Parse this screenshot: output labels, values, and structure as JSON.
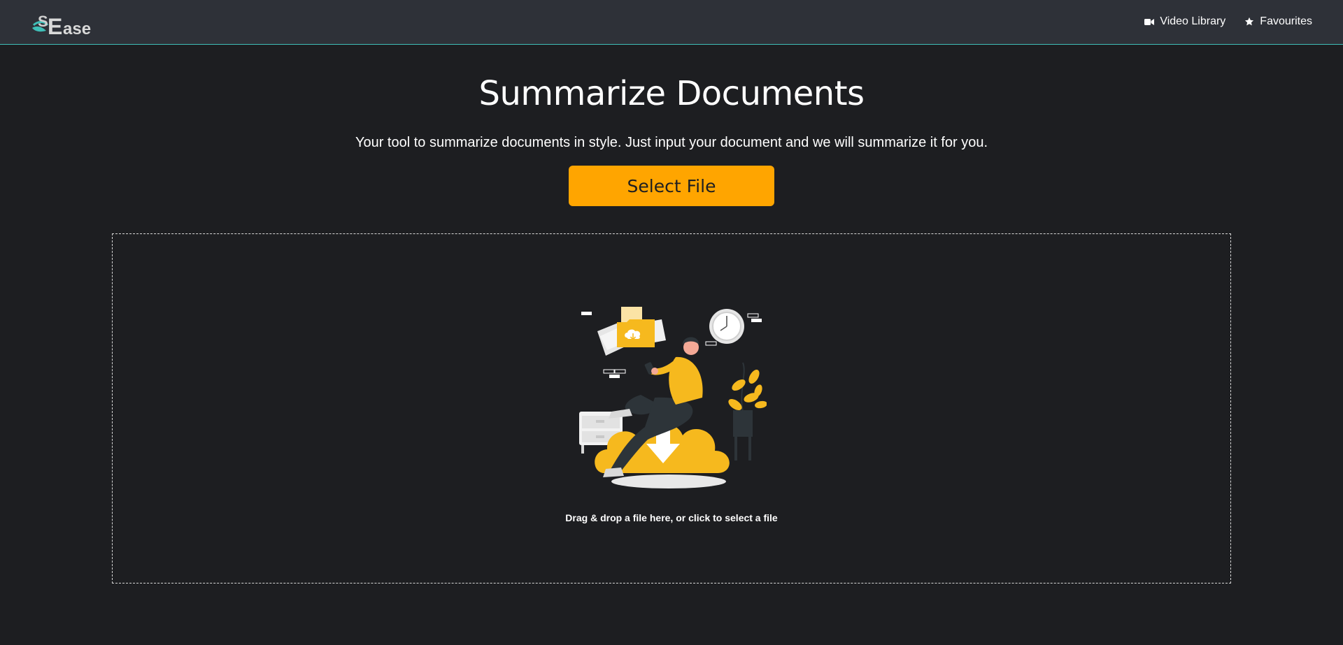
{
  "app": {
    "logo_text": "SEase"
  },
  "nav": {
    "items": [
      {
        "label": "Video Library",
        "icon": "video-camera-icon"
      },
      {
        "label": "Favourites",
        "icon": "star-icon"
      }
    ]
  },
  "main": {
    "title": "Summarize Documents",
    "subtitle": "Your tool to summarize documents in style. Just input your document and we will summarize it for you.",
    "select_button_label": "Select File",
    "dropzone": {
      "instruction": "Drag & drop a file here, or click to select a file",
      "illustration": "person-uploading-files-illustration"
    }
  },
  "colors": {
    "navbar_bg": "#2e3138",
    "page_bg": "#1d1e21",
    "accent": "#ffa500",
    "navbar_border": "#3fbfb8",
    "illustration_yellow": "#f6b91e"
  }
}
